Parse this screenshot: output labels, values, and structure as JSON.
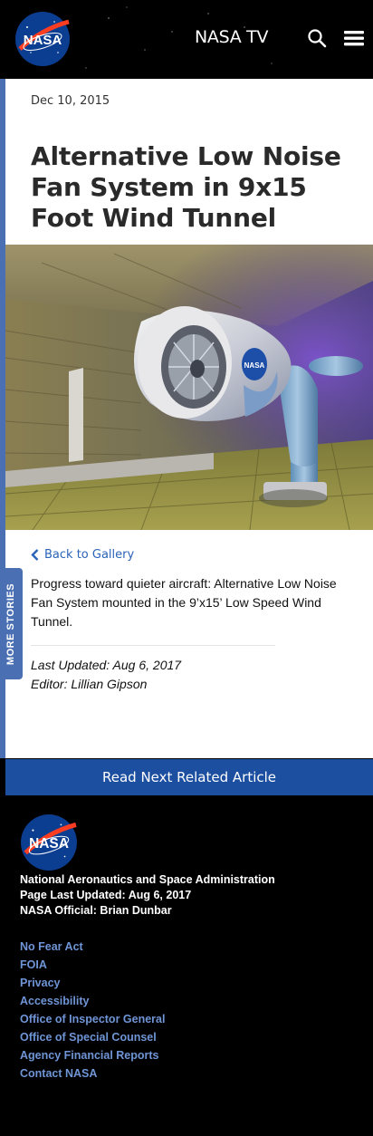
{
  "header": {
    "logo_text": "NASA",
    "nav_title": "NASA TV"
  },
  "article": {
    "date": "Dec 10, 2015",
    "title": "Alternative Low Noise Fan System in 9x15 Foot Wind Tunnel",
    "back_link": "Back to Gallery",
    "caption": "Progress toward quieter aircraft: Alternative Low Noise Fan System mounted in the 9’x15’ Low Speed Wind Tunnel.",
    "last_updated": "Last Updated: Aug 6, 2017",
    "editor": "Editor: Lillian Gipson",
    "image_logo_text": "NASA"
  },
  "sidebar_tab": {
    "label": "MORE STORIES"
  },
  "read_next": {
    "label": "Read Next Related Article"
  },
  "footer": {
    "logo_text": "NASA",
    "agency": "National Aeronautics and Space Administration",
    "page_updated": "Page Last Updated: Aug 6, 2017",
    "official": "NASA Official: Brian Dunbar",
    "links": [
      "No Fear Act",
      "FOIA",
      "Privacy",
      "Accessibility",
      "Office of Inspector General",
      "Office of Special Counsel",
      "Agency Financial Reports",
      "Contact NASA"
    ]
  },
  "colors": {
    "accent_blue": "#1c4fa0",
    "side_tab": "#4a6fb3",
    "link": "#2a63b8",
    "footer_link": "#6f95d6"
  },
  "icons": [
    "nasa-meatball-logo",
    "search-icon",
    "hamburger-menu-icon",
    "chevron-left-icon"
  ]
}
